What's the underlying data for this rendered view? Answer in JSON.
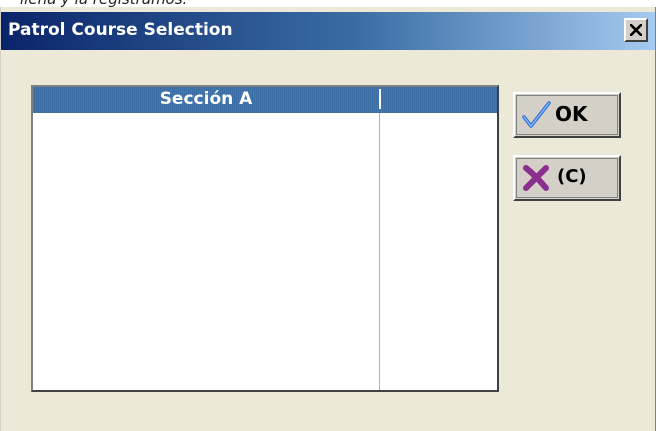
{
  "background_text": "llena y la registramos.",
  "window": {
    "title": "Patrol Course Selection",
    "close_label": "Close"
  },
  "list": {
    "columns": [
      {
        "label": "Sección A"
      },
      {
        "label": ""
      }
    ],
    "rows": []
  },
  "buttons": {
    "ok_label": "OK",
    "cancel_label": "(C)"
  },
  "icons": {
    "close": "close-x-icon",
    "ok": "checkmark-icon",
    "cancel": "x-cross-icon"
  },
  "colors": {
    "titlebar_start": "#0a246a",
    "titlebar_end": "#a6caf0",
    "header_bg": "#3a6ea5",
    "dialog_bg": "#ece9d8",
    "check_color": "#2f6fd6",
    "cross_color": "#8b2f8f"
  }
}
